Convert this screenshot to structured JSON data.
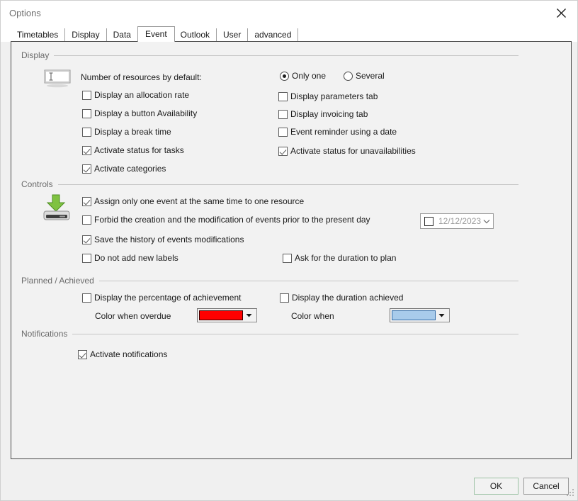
{
  "window": {
    "title": "Options",
    "close_icon": "close-icon"
  },
  "tabs": [
    {
      "label": "Timetables",
      "active": false
    },
    {
      "label": "Display",
      "active": false
    },
    {
      "label": "Data",
      "active": false
    },
    {
      "label": "Event",
      "active": true
    },
    {
      "label": "Outlook",
      "active": false
    },
    {
      "label": "User",
      "active": false
    },
    {
      "label": "advanced",
      "active": false
    }
  ],
  "groups": {
    "display": {
      "label": "Display",
      "icon": "text-field-icon",
      "resources_label": "Number of resources by default:",
      "radios": [
        {
          "label": "Only one",
          "selected": true
        },
        {
          "label": "Several",
          "selected": false
        }
      ],
      "left_checkboxes": [
        {
          "label": "Display an allocation rate",
          "checked": false
        },
        {
          "label": "Display a button Availability",
          "checked": false
        },
        {
          "label": "Display a break time",
          "checked": false
        },
        {
          "label": "Activate status for tasks",
          "checked": true
        },
        {
          "label": "Activate categories",
          "checked": true
        }
      ],
      "right_checkboxes": [
        {
          "label": "Display parameters tab",
          "checked": false
        },
        {
          "label": "Display invoicing tab",
          "checked": false
        },
        {
          "label": "Event reminder using a date",
          "checked": false
        },
        {
          "label": "Activate status for unavailabilities",
          "checked": true
        }
      ]
    },
    "controls": {
      "label": "Controls",
      "icon": "save-drive-icon",
      "checkboxes": [
        {
          "label": "Assign only one event at the same time to one resource",
          "checked": true
        },
        {
          "label": "Forbid the creation and the modification of events prior to the present day",
          "checked": false
        },
        {
          "label": "Save the history of events modifications",
          "checked": true
        },
        {
          "label": "Do not add new labels",
          "checked": false
        },
        {
          "label": "Ask for the duration to plan",
          "checked": false
        }
      ],
      "date_picker": {
        "checked": false,
        "value": "12/12/2023",
        "chevron_icon": "chevron-down-icon"
      }
    },
    "planned": {
      "label": "Planned / Achieved",
      "checkboxes": [
        {
          "label": "Display the percentage of achievement",
          "checked": false
        },
        {
          "label": "Display the duration achieved",
          "checked": false
        }
      ],
      "color_overdue": {
        "label": "Color when overdue",
        "swatch": "#FF0000",
        "swatch_border": "#3a0000",
        "arrow_icon": "dropdown-arrow-icon"
      },
      "color_when": {
        "label": "Color when",
        "swatch": "#A8CBEB",
        "swatch_border": "#2f6aa8",
        "arrow_icon": "dropdown-arrow-icon"
      }
    },
    "notifications": {
      "label": "Notifications",
      "checkboxes": [
        {
          "label": "Activate notifications",
          "checked": true
        }
      ]
    }
  },
  "footer": {
    "ok_label": "OK",
    "cancel_label": "Cancel"
  }
}
